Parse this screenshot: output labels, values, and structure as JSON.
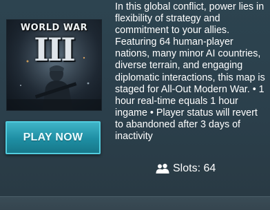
{
  "game": {
    "cover_title": "WORLD WAR",
    "cover_numeral": "III",
    "play_button_label": "PLAY NOW",
    "description": "In this global conflict, power lies in flexibility of strategy and commitment to your allies. Featuring 64 human-player nations, many minor AI countries, diverse terrain, and engaging diplomatic interactions, this map is staged for All-Out Modern War. • 1 hour real-time equals 1 hour ingame • Player status will revert to abandoned after 3 days of inactivity",
    "slots_text": "Slots: 64",
    "slots_icon": "users-icon"
  },
  "colors": {
    "panel_bg": "#2b3f4b",
    "button_accent": "#1e8ea3",
    "button_border": "#52cddf",
    "text": "#ffffff"
  }
}
